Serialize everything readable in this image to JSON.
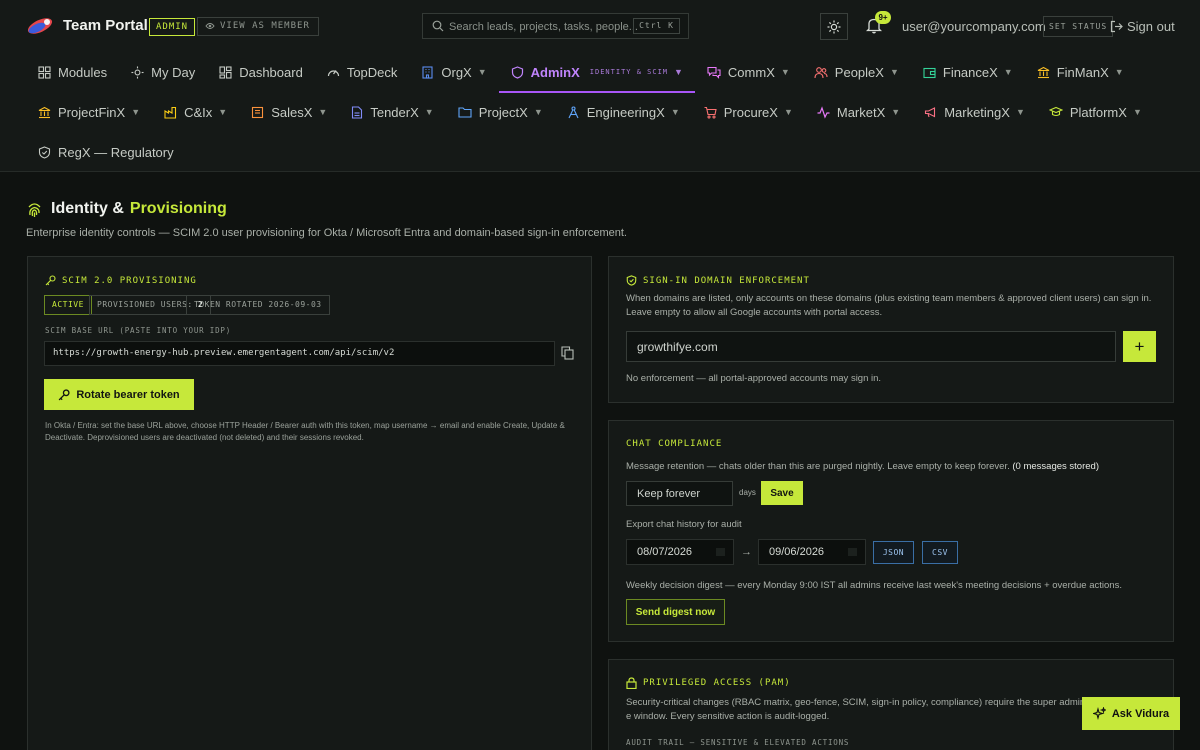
{
  "app": {
    "brand": "Team Portal",
    "role_badge": "ADMIN",
    "view_as_member": "VIEW AS MEMBER",
    "search_placeholder": "Search leads, projects, tasks, people...",
    "search_shortcut": "Ctrl K",
    "notification_count": "9+",
    "user_email": "user@yourcompany.com",
    "set_status": "SET STATUS",
    "sign_out": "Sign out"
  },
  "nav": {
    "row1": [
      {
        "label": "Modules",
        "icon": "grid-icon"
      },
      {
        "label": "My Day",
        "icon": "sun-icon"
      },
      {
        "label": "Dashboard",
        "icon": "dashboard-icon"
      },
      {
        "label": "TopDeck",
        "icon": "gauge-icon"
      },
      {
        "label": "OrgX",
        "icon": "building-icon",
        "chevron": true
      },
      {
        "label": "AdminX",
        "icon": "shield-icon",
        "chevron": true,
        "active": true,
        "sub": "IDENTITY & SCIM"
      },
      {
        "label": "CommX",
        "icon": "chat-icon",
        "chevron": true
      },
      {
        "label": "PeopleX",
        "icon": "people-icon",
        "chevron": true
      },
      {
        "label": "FinanceX",
        "icon": "wallet-icon",
        "chevron": true
      },
      {
        "label": "FinManX",
        "icon": "bank-icon",
        "chevron": true
      }
    ],
    "row2": [
      {
        "label": "ProjectFinX",
        "icon": "bank-icon",
        "chevron": true
      },
      {
        "label": "C&Ix",
        "icon": "factory-icon",
        "chevron": true
      },
      {
        "label": "SalesX",
        "icon": "receipt-icon",
        "chevron": true
      },
      {
        "label": "TenderX",
        "icon": "document-icon",
        "chevron": true
      },
      {
        "label": "ProjectX",
        "icon": "folder-icon",
        "chevron": true
      },
      {
        "label": "EngineeringX",
        "icon": "compass-icon",
        "chevron": true
      },
      {
        "label": "ProcureX",
        "icon": "cart-icon",
        "chevron": true
      },
      {
        "label": "MarketX",
        "icon": "pulse-icon",
        "chevron": true
      },
      {
        "label": "MarketingX",
        "icon": "megaphone-icon",
        "chevron": true
      },
      {
        "label": "PlatformX",
        "icon": "graduation-icon",
        "chevron": true
      }
    ],
    "row3": [
      {
        "label": "RegX — Regulatory",
        "icon": "shield-check-icon"
      }
    ]
  },
  "page": {
    "title_part1": "Identity &",
    "title_part2": "Provisioning",
    "subtitle": "Enterprise identity controls — SCIM 2.0 user provisioning for Okta / Microsoft Entra and domain-based sign-in enforcement."
  },
  "scim": {
    "heading": "SCIM 2.0 PROVISIONING",
    "status": "ACTIVE",
    "provisioned_label": "PROVISIONED USERS:",
    "provisioned_count": "2",
    "token_rotated": "TOKEN ROTATED 2026-09-03",
    "base_url_label": "SCIM BASE URL (PASTE INTO YOUR IDP)",
    "base_url": "https://growth-energy-hub.preview.emergentagent.com/api/scim/v2",
    "rotate_button": "Rotate bearer token",
    "help": "In Okta / Entra: set the base URL above, choose HTTP Header / Bearer auth with this token, map username → email and enable Create, Update & Deactivate. Deprovisioned users are deactivated (not deleted) and their sessions revoked."
  },
  "domain": {
    "heading": "SIGN-IN DOMAIN ENFORCEMENT",
    "description": "When domains are listed, only accounts on these domains (plus existing team members & approved client users) can sign in. Leave empty to allow all Google accounts with portal access.",
    "input_value": "growthifye.com",
    "add_button": "+",
    "status": "No enforcement — all portal-approved accounts may sign in."
  },
  "chat": {
    "heading": "CHAT COMPLIANCE",
    "retention_text": "Message retention — chats older than this are purged nightly. Leave empty to keep forever.",
    "messages_stored": "(0 messages stored)",
    "retention_value": "Keep forever",
    "days_label": "days",
    "save_button": "Save",
    "export_label": "Export chat history for audit",
    "date_from": "08/07/2026",
    "arrow": "→",
    "date_to": "09/06/2026",
    "json_button": "JSON",
    "csv_button": "CSV",
    "digest_text": "Weekly decision digest — every Monday 9:00 IST all admins receive last week's meeting decisions + overdue actions.",
    "digest_button": "Send digest now"
  },
  "pam": {
    "heading": "PRIVILEGED ACCESS (PAM)",
    "description": "Security-critical changes (RBAC matrix, geo-fence, SCIM, sign-in policy, compliance) require the super admin to e window. Every sensitive action is audit-logged.",
    "audit_label": "AUDIT TRAIL — SENSITIVE & ELEVATED ACTIONS"
  },
  "assistant": {
    "label": "Ask Vidura"
  },
  "colors": {
    "accent": "#c6e83a",
    "active_nav": "#a855f7",
    "background": "#0f1210"
  }
}
